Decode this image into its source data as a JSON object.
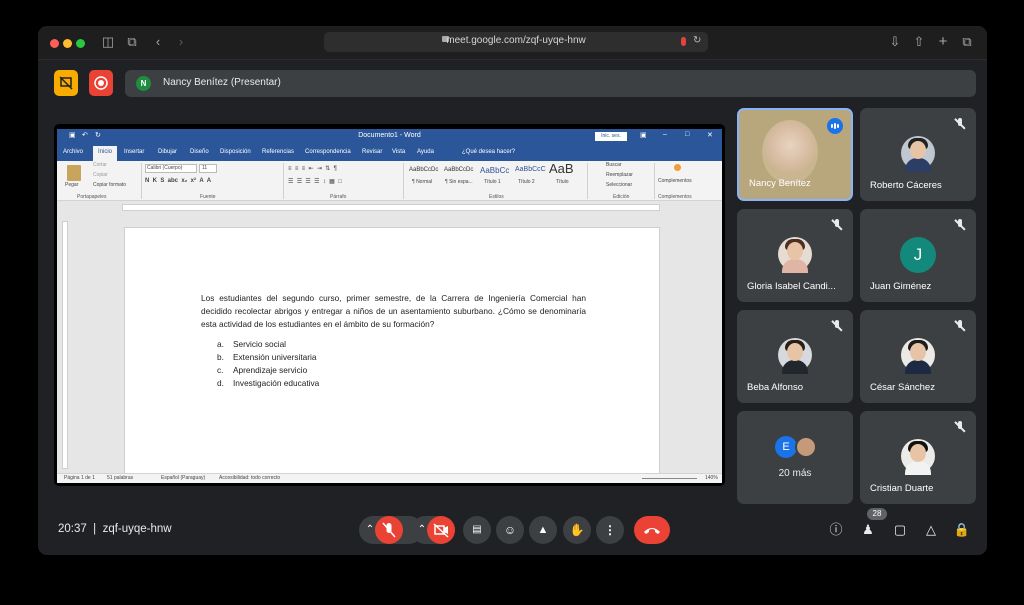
{
  "browser": {
    "url": "meet.google.com/zqf-uyqe-hnw",
    "traffic_lights": [
      "#ff5f57",
      "#febc2e",
      "#28c840"
    ]
  },
  "meet": {
    "presenter_initial": "N",
    "presenter_text": "Nancy Benítez (Presentar)",
    "time": "20:37",
    "separator": "|",
    "meeting_code": "zqf-uyqe-hnw",
    "participants_count": "28",
    "tiles": [
      {
        "name": "Nancy Benítez",
        "speaking": true
      },
      {
        "name": "Roberto Cáceres",
        "muted": true
      },
      {
        "name": "Gloria Isabel Candi...",
        "muted": true
      },
      {
        "name": "Juan Giménez",
        "initial": "J",
        "muted": true
      },
      {
        "name": "Beba Alfonso",
        "muted": true
      },
      {
        "name": "César Sánchez",
        "muted": true
      },
      {
        "more_initial": "E",
        "more_text": "20 más"
      },
      {
        "name": "Cristian Duarte",
        "muted": true
      }
    ]
  },
  "word": {
    "title": "Documento1 - Word",
    "signin": "Inic. ses.",
    "tabs": [
      "Archivo",
      "Inicio",
      "Insertar",
      "Dibujar",
      "Diseño",
      "Disposición",
      "Referencias",
      "Correspondencia",
      "Revisar",
      "Vista",
      "Ayuda",
      "¿Qué desea hacer?"
    ],
    "ribbon": {
      "paste": "Pegar",
      "cut": "Cortar",
      "copy": "Copiar",
      "format_painter": "Copiar formato",
      "font": "Calibri (Cuerpo)",
      "font_size": "11",
      "styles": [
        "AaBbCcDc",
        "AaBbCcDc",
        "AaBbCc",
        "AaBbCcC",
        "AaB"
      ],
      "style_names": [
        "¶ Normal",
        "¶ Sin espa...",
        "Título 1",
        "Título 2",
        "Título"
      ],
      "find": "Buscar",
      "replace": "Reemplazar",
      "select": "Seleccionar",
      "addins": "Complementos",
      "groups": [
        "Portapapeles",
        "Fuente",
        "Párrafo",
        "Estilos",
        "Edición",
        "Complementos"
      ]
    },
    "paragraph": "Los estudiantes del segundo curso, primer semestre, de la Carrera de Ingeniería Comercial han decidido recolectar abrigos y entregar a niños de un asentamiento suburbano. ¿Cómo se denominaría esta actividad de los estudiantes en el ámbito de su formación?",
    "options": [
      {
        "letter": "a.",
        "text": "Servicio social"
      },
      {
        "letter": "b.",
        "text": "Extensión universitaria"
      },
      {
        "letter": "c.",
        "text": "Aprendizaje servicio"
      },
      {
        "letter": "d.",
        "text": "Investigación educativa"
      }
    ],
    "status": {
      "page": "Página 1 de 1",
      "words": "51 palabras",
      "lang": "Español (Paraguay)",
      "access": "Accesibilidad: todo correcto",
      "zoom": "140%"
    }
  }
}
